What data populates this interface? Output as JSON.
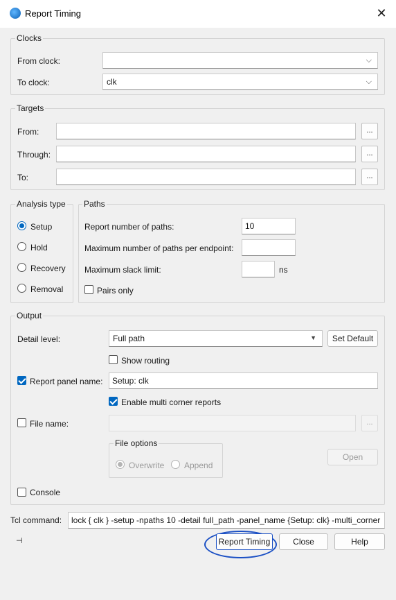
{
  "window": {
    "title": "Report Timing",
    "close_glyph": "✕",
    "icon": "quartus-globe-icon"
  },
  "clocks": {
    "label": "Clocks",
    "from_label": "From clock:",
    "from_value": "",
    "to_label": "To clock:",
    "to_value": "clk"
  },
  "targets": {
    "label": "Targets",
    "from_label": "From:",
    "through_label": "Through:",
    "to_label": "To:",
    "browse": "..."
  },
  "analysis": {
    "label": "Analysis type",
    "options": [
      "Setup",
      "Hold",
      "Recovery",
      "Removal"
    ],
    "selected": "Setup"
  },
  "paths": {
    "label": "Paths",
    "num_paths_label": "Report number of paths:",
    "num_paths_value": "10",
    "max_per_endpoint_label": "Maximum number of paths per endpoint:",
    "max_per_endpoint_value": "",
    "max_slack_label": "Maximum slack limit:",
    "max_slack_value": "",
    "max_slack_unit": "ns",
    "pairs_only_label": "Pairs only",
    "pairs_only_checked": false
  },
  "output": {
    "label": "Output",
    "detail_label": "Detail level:",
    "detail_value": "Full path",
    "set_default": "Set Default",
    "show_routing_label": "Show routing",
    "show_routing_checked": false,
    "panel_name_label": "Report panel name:",
    "panel_name_checked": true,
    "panel_name_value": "Setup: clk",
    "multi_corner_label": "Enable multi corner reports",
    "multi_corner_checked": true,
    "file_name_label": "File name:",
    "file_name_checked": false,
    "file_name_value": "",
    "browse": "...",
    "file_options_label": "File options",
    "overwrite_label": "Overwrite",
    "append_label": "Append",
    "open_label": "Open",
    "console_label": "Console",
    "console_checked": false
  },
  "tcl": {
    "label": "Tcl command:",
    "value": "lock { clk } -setup -npaths 10 -detail full_path -panel_name {Setup: clk} -multi_corner"
  },
  "footer": {
    "pin_glyph": "⊣",
    "report_timing": "Report Timing",
    "close": "Close",
    "help": "Help"
  },
  "colors": {
    "accent": "#0067c0",
    "annotation": "#1a4fc4"
  }
}
